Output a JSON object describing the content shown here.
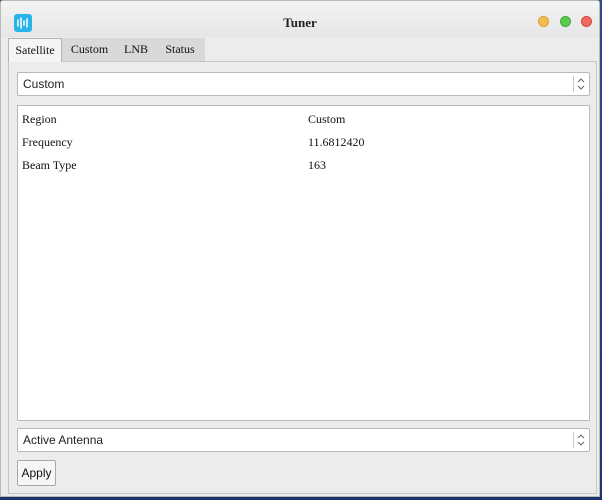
{
  "window": {
    "title": "Tuner",
    "app_icon": "waveform-icon",
    "controls": [
      "minimize-icon",
      "maximize-icon",
      "close-icon"
    ]
  },
  "tabs": [
    {
      "label": "Satellite",
      "active": true
    },
    {
      "label": "Custom",
      "active": false
    },
    {
      "label": "LNB",
      "active": false
    },
    {
      "label": "Status",
      "active": false
    }
  ],
  "satellite_select": {
    "value": "Custom"
  },
  "properties": {
    "rows": [
      {
        "key": "Region",
        "value": "Custom"
      },
      {
        "key": "Frequency",
        "value": "11.6812420"
      },
      {
        "key": "Beam Type",
        "value": "163"
      }
    ]
  },
  "antenna_select": {
    "value": "Active Antenna"
  },
  "apply_label": "Apply",
  "colors": {
    "app_icon": "#28b4e8",
    "minimize": "#f4bd4f",
    "maximize": "#5fcb4e",
    "close": "#ef6b60"
  }
}
